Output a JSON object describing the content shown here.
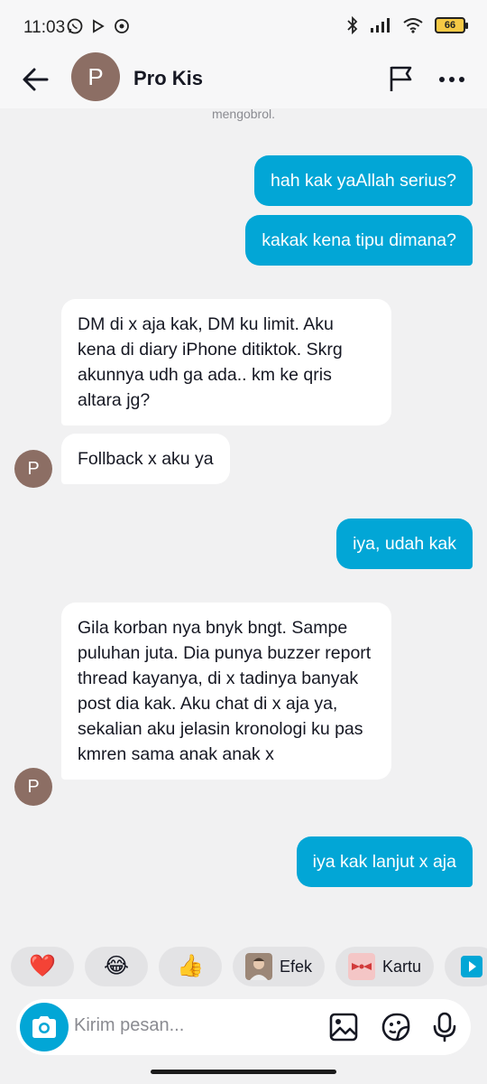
{
  "status_bar": {
    "time": "11:03",
    "battery": "66",
    "left_icons": [
      "whatsapp-icon",
      "play-icon",
      "notification-icon"
    ],
    "right_icons": [
      "bluetooth-icon",
      "signal-icon",
      "wifi-icon",
      "battery-icon"
    ]
  },
  "header": {
    "avatar_letter": "P",
    "title": "Pro Kis",
    "icons": [
      "back-arrow-icon",
      "flag-icon",
      "more-icon"
    ]
  },
  "chat": {
    "system_note": "mengobrol.",
    "messages": [
      {
        "from": "me",
        "text": "hah kak yaAllah serius?"
      },
      {
        "from": "me",
        "text": "kakak kena tipu dimana?"
      },
      {
        "from": "other",
        "text": "DM di x aja kak, DM ku limit. Aku kena di diary iPhone ditiktok. Skrg akunnya udh ga ada.. km ke qris altara jg?"
      },
      {
        "from": "other",
        "text": "Follback x aku ya"
      },
      {
        "from": "me",
        "text": "iya, udah kak"
      },
      {
        "from": "other",
        "text": "Gila korban nya bnyk bngt. Sampe puluhan juta. Dia punya buzzer report thread kayanya, di x tadinya banyak post dia kak. Aku chat di x aja ya, sekalian aku jelasin kronologi ku pas kmren sama anak anak x"
      },
      {
        "from": "me",
        "text": "iya kak lanjut x aja"
      }
    ],
    "other_avatar_letter": "P"
  },
  "reactions": [
    {
      "emoji": "❤️",
      "label": ""
    },
    {
      "emoji": "😂",
      "label": ""
    },
    {
      "emoji": "👍",
      "label": ""
    },
    {
      "emoji": "",
      "label": "Efek"
    },
    {
      "emoji": "",
      "label": "Kartu"
    }
  ],
  "input": {
    "placeholder": "Kirim pesan...",
    "icons": [
      "camera-icon",
      "image-icon",
      "sticker-icon",
      "microphone-icon"
    ]
  },
  "colors": {
    "accent": "#02a6d6",
    "background": "#f1f1f2",
    "incoming_bubble": "#ffffff",
    "avatar": "#8c6e64"
  }
}
